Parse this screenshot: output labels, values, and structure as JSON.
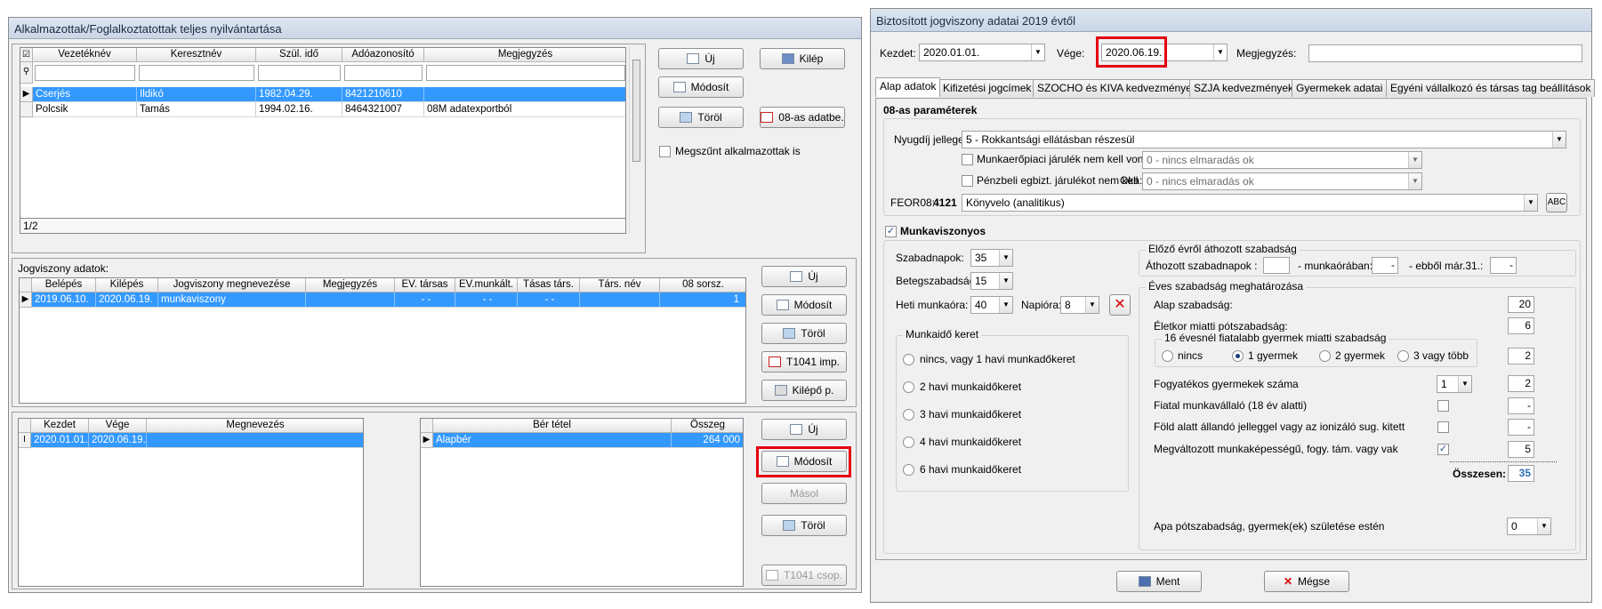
{
  "left_window": {
    "title": "Alkalmazottak/Foglalkoztatottak teljes nyilvántartása",
    "employees": {
      "columns": [
        "Vezetéknév",
        "Keresztnév",
        "Szül. idő",
        "Adóazonosító",
        "Megjegyzés"
      ],
      "rows": [
        {
          "last": "Cserjés",
          "first": "Ildikó",
          "birth": "1982.04.29.",
          "tax": "8421210610",
          "note": ""
        },
        {
          "last": "Polcsik",
          "first": "Tamás",
          "birth": "1994.02.16.",
          "tax": "8464321007",
          "note": "08M adatexportból"
        }
      ],
      "footer": "1/2"
    },
    "buttons": {
      "new": "Új",
      "exit": "Kilép",
      "modify": "Módosít",
      "delete": "Töröl",
      "data08": "08-as adatbe.",
      "ended_label": "Megszűnt alkalmazottak is"
    },
    "relationship": {
      "label": "Jogviszony adatok:",
      "columns": [
        "Belépés",
        "Kilépés",
        "Jogviszony megnevezése",
        "Megjegyzés",
        "EV. társas",
        "EV.munkált.",
        "Tásas társ.",
        "Társ. név",
        "08 sorsz."
      ],
      "row": {
        "start": "2019.06.10.",
        "end": "2020.06.19.",
        "name": "munkaviszony",
        "note": "",
        "c5": "- -",
        "c6": "- -",
        "c7": "- -",
        "c8": "",
        "c9": "1"
      },
      "buttons": {
        "new": "Új",
        "modify": "Módosít",
        "delete": "Töröl",
        "t1041": "T1041 imp.",
        "exit_p": "Kilépő p."
      }
    },
    "periods": {
      "columns": [
        "Kezdet",
        "Vége",
        "Megnevezés"
      ],
      "row": {
        "start": "2020.01.01.",
        "end": "2020.06.19.",
        "name": ""
      },
      "wage_columns": [
        "Bér tétel",
        "Összeg"
      ],
      "wage_row": {
        "item": "Alapbér",
        "amount": "264 000"
      },
      "buttons": {
        "new": "Új",
        "modify": "Módosít",
        "copy": "Másol",
        "delete": "Töröl",
        "t1041c": "T1041 csop."
      }
    }
  },
  "right_window": {
    "title": "Biztosított jogviszony adatai 2019 évtől",
    "start_label": "Kezdet:",
    "start_value": "2020.01.01.",
    "end_label": "Vége:",
    "end_value": "2020.06.19.",
    "note_label": "Megjegyzés:",
    "note_value": "",
    "tabs": [
      "Alap adatok",
      "Kifizetési jogcímek",
      "SZOCHO és KIVA kedvezmények",
      "SZJA kedvezmények",
      "Gyermekek adatai",
      "Egyéni vállalkozó és társas tag beállítások"
    ],
    "params08": {
      "title": "08-as paraméterek",
      "pension_label": "Nyugdíj jellege:",
      "pension_value": "5 - Rokkantsági ellátásban részesül",
      "labor_chk_label": "Munkaerőpiaci járulék nem kell vonni",
      "labor_value": "0 - nincs elmaradás ok",
      "cash_chk_label": "Pénzbeli egbizt. járulékot nem kell",
      "reason_label": "Oka:",
      "cash_value": "0 - nincs elmaradás ok",
      "feor_label": "FEOR08:",
      "feor_code": "4121",
      "feor_value": "Könyvelo (analitikus)",
      "abc": "ABC"
    },
    "employment": {
      "title": "Munkaviszonyos",
      "leave_days_label": "Szabadnapok:",
      "leave_days": "35",
      "sick_label": "Betegszabadság:",
      "sick": "15",
      "weekly_label": "Heti munkaóra:",
      "weekly": "40",
      "daily_label": "Napióra:",
      "daily": "8",
      "frame_title": "Munkaidő keret",
      "frames": [
        "nincs, vagy 1 havi munkadőkeret",
        "2 havi munkaidőkeret",
        "3 havi munkaidőkeret",
        "4 havi munkaidőkeret",
        "6 havi munkaidőkeret"
      ],
      "carry_title": "Előző évről áthozott szabadság",
      "carry_days_label": "Áthozott szabadnapok :",
      "carry_days": "",
      "carry_hours_label": "- munkaórában:",
      "carry_hours": "-",
      "carry_march_label": "- ebből már.31.:",
      "carry_march": "-",
      "annual_title": "Éves szabadság meghatározása",
      "base_label": "Alap szabadság:",
      "base": "20",
      "age_label": "Életkor miatti pótszabadság:",
      "age": "6",
      "child_title": "16 évesnél fiatalabb gyermek miatti szabadság",
      "child_opts": [
        "nincs",
        "1 gyermek",
        "2 gyermek",
        "3 vagy több"
      ],
      "child_value": "2",
      "disabled_label": "Fogyatékos gyermekek száma",
      "disabled_count": "1",
      "disabled_value": "2",
      "young_label": "Fiatal munkavállaló (18 év alatti)",
      "young_value": "-",
      "under_label": "Föld alatt állandó jelleggel vagy az ionizáló sug. kitett",
      "under_value": "-",
      "changed_label": "Megváltozott munkaképességű, fogy. tám. vagy vak",
      "changed_value": "5",
      "total_label": "Összesen:",
      "total": "35",
      "father_label": "Apa pótszabadság, gyermek(ek) születése estén",
      "father": "0"
    },
    "buttons": {
      "save": "Ment",
      "cancel": "Mégse"
    }
  }
}
